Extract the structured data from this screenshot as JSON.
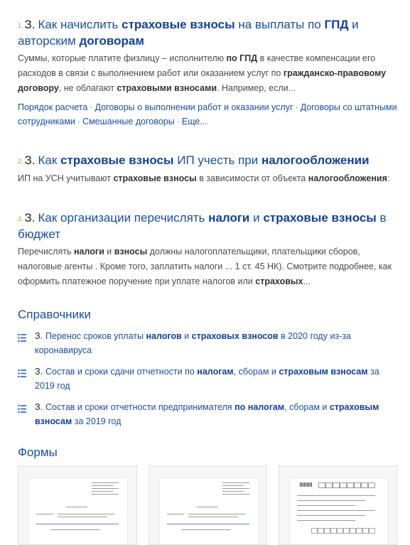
{
  "results": [
    {
      "num": "1.",
      "pre": "З.",
      "title": [
        {
          "t": "Как начислить "
        },
        {
          "t": "страховые взносы",
          "b": true
        },
        {
          "t": " на выплаты по "
        },
        {
          "t": "ГПД",
          "b": true
        },
        {
          "t": " и авторским "
        },
        {
          "t": "договорам",
          "b": true
        }
      ],
      "snippet": [
        {
          "t": "Суммы, которые платите физлицу – исполнителю "
        },
        {
          "t": "по ГПД",
          "b": true
        },
        {
          "t": " в качестве компенсации его расходов в связи с выполнением работ или оказанием услуг по "
        },
        {
          "t": "гражданско-правовому договору",
          "b": true
        },
        {
          "t": ", не облагают "
        },
        {
          "t": "страховыми взносами",
          "b": true
        },
        {
          "t": ". Например, если..."
        }
      ],
      "links": [
        "Порядок расчета",
        "Договоры о выполнении работ и оказании услуг",
        "Договоры со штатными сотрудниками",
        "Смешанные договоры",
        "Еще..."
      ]
    },
    {
      "num": "2.",
      "pre": "З.",
      "title": [
        {
          "t": "Как "
        },
        {
          "t": "страховые взносы",
          "b": true
        },
        {
          "t": " ИП учесть при "
        },
        {
          "t": "налогообложении",
          "b": true
        }
      ],
      "snippet": [
        {
          "t": "ИП на УСН учитывают "
        },
        {
          "t": "страховые взносы",
          "b": true
        },
        {
          "t": " в зависимости от объекта "
        },
        {
          "t": "налогообложения",
          "b": true
        },
        {
          "t": ":"
        }
      ],
      "links": []
    },
    {
      "num": "3.",
      "pre": "З.",
      "title": [
        {
          "t": "Как организации перечислять "
        },
        {
          "t": "налоги",
          "b": true
        },
        {
          "t": " и "
        },
        {
          "t": "страховые взносы",
          "b": true
        },
        {
          "t": " в бюджет"
        }
      ],
      "snippet": [
        {
          "t": "Перечислять "
        },
        {
          "t": "налоги",
          "b": true
        },
        {
          "t": " и "
        },
        {
          "t": "взносы",
          "b": true
        },
        {
          "t": " должны налогоплательщики, плательщики сборов, налоговые агенты . Кроме того, заплатить налоги ... 1 ст. 45 НК). Смотрите подробнее, как оформить платежное поручение при уплате налогов или "
        },
        {
          "t": "страховых",
          "b": true
        },
        {
          "t": "..."
        }
      ],
      "links": []
    }
  ],
  "references": {
    "heading": "Справочники",
    "items": [
      {
        "pre": "З.",
        "parts": [
          {
            "t": "Перенос сроков уплаты "
          },
          {
            "t": "налогов",
            "b": true
          },
          {
            "t": " и "
          },
          {
            "t": "страховых взносов",
            "b": true
          },
          {
            "t": " в 2020 году из-за коронавируса"
          }
        ]
      },
      {
        "pre": "З.",
        "parts": [
          {
            "t": "Состав и сроки сдачи отчетности по "
          },
          {
            "t": "налогам",
            "b": true
          },
          {
            "t": ", сборам и "
          },
          {
            "t": "страховым взносам",
            "b": true
          },
          {
            "t": " за 2019 год"
          }
        ]
      },
      {
        "pre": "З.",
        "parts": [
          {
            "t": "Состав и сроки отчетности предпринимателя "
          },
          {
            "t": "по налогам",
            "b": true
          },
          {
            "t": ", сборам и "
          },
          {
            "t": "страховым взносам",
            "b": true
          },
          {
            "t": " за 2019 год"
          }
        ]
      }
    ]
  },
  "forms": {
    "heading": "Формы",
    "cards": 3
  },
  "colors": {
    "link": "#1a4fa0",
    "bold_link": "#12409a",
    "number_accent": "#e08a2a",
    "icon": "#4a7fd0"
  },
  "icons": {
    "reference_item": "list-doc-icon"
  }
}
